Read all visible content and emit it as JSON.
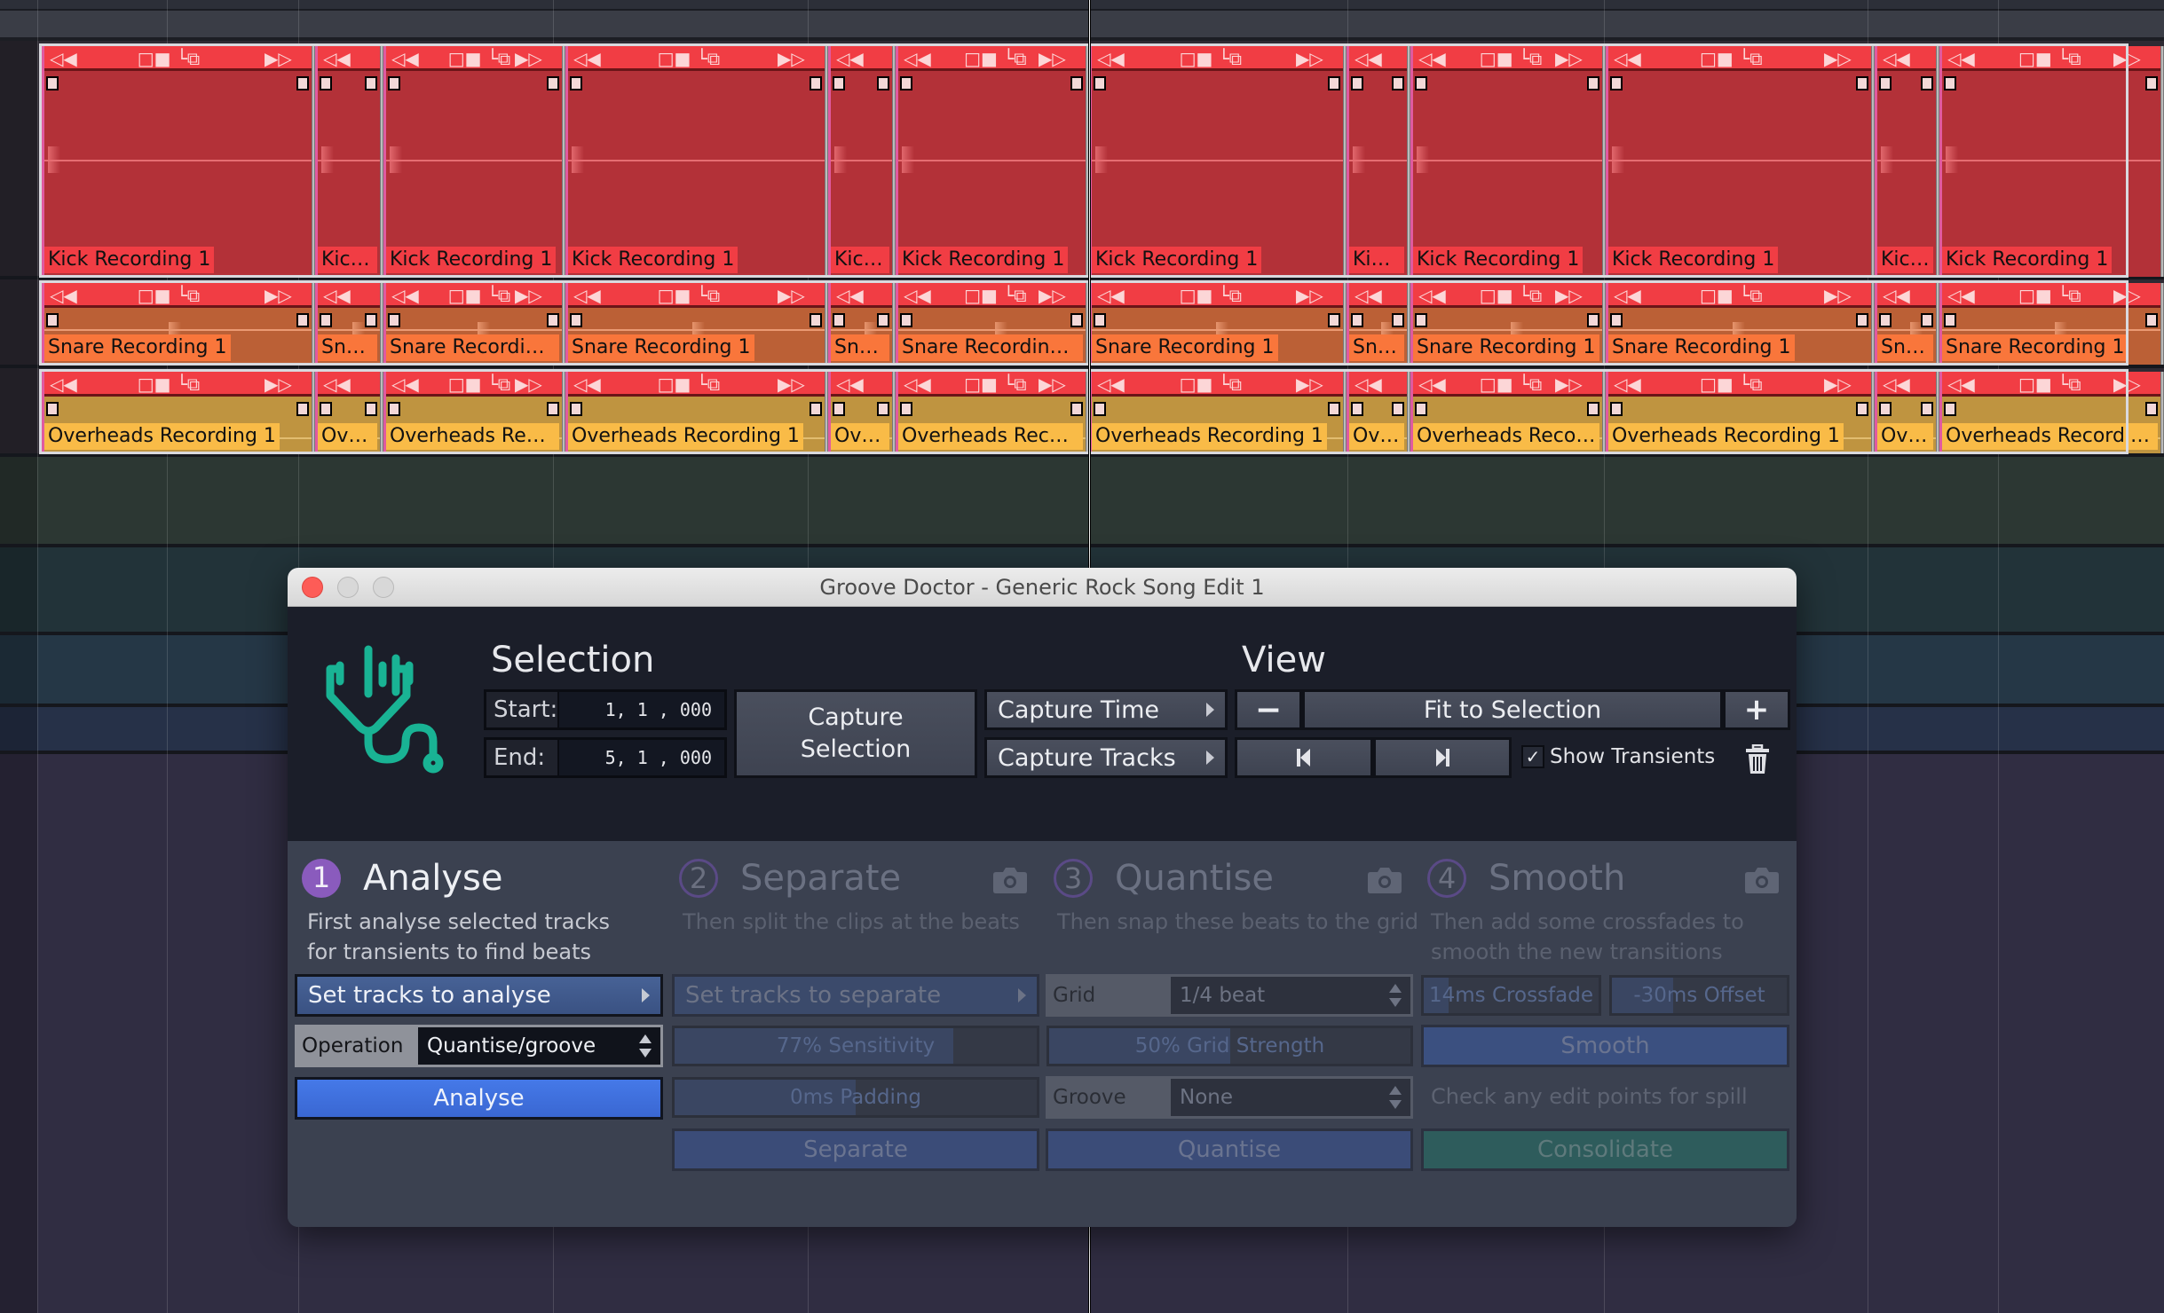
{
  "window": {
    "title": "Groove Doctor - Generic Rock Song Edit 1"
  },
  "tracks": [
    {
      "id": "kick",
      "clip_name": "Kick Recording 1",
      "truncated": "Kick ...",
      "color": "#f13d44"
    },
    {
      "id": "snare",
      "clip_name": "Snare Recording 1",
      "truncated": "Snar...",
      "color": "#f9763b"
    },
    {
      "id": "overheads",
      "clip_name": "Overheads Recording 1",
      "truncated": "Ove...",
      "color": "#f9bb47"
    }
  ],
  "clips": {
    "kick": [
      "Kick Recording 1",
      "Kick ...",
      "Kick Recording 1",
      "Kick Recording 1",
      "Kick ...",
      "Kick Recording 1",
      "Kick Recording 1",
      "Kick...",
      "Kick Recording 1",
      "Kick Recording 1",
      "Kick...",
      "Kick Recording 1"
    ],
    "snare": [
      "Snare Recording 1",
      "Snar...",
      "Snare Recording 1",
      "Snare Recording 1",
      "Snar...",
      "Snare Recording 1",
      "Snare Recording 1",
      "Sna...",
      "Snare Recording 1",
      "Snare Recording 1",
      "Sna...",
      "Snare Recording 1"
    ],
    "overheads": [
      "Overheads Recording 1",
      "Ove...",
      "Overheads Reco...",
      "Overheads Recording 1",
      "Ove...",
      "Overheads Recor...",
      "Overheads Recording 1",
      "Ove...",
      "Overheads Recor...",
      "Overheads Recording 1",
      "Ove...",
      "Overheads Recording 1"
    ]
  },
  "clip_controls": {
    "nudge_left": "◁◀",
    "mid": "□■ └⧉",
    "nudge_right": "▶▷"
  },
  "selection": {
    "heading": "Selection",
    "start_label": "Start:",
    "start_value": "1, 1 , 000",
    "end_label": "End:",
    "end_value": "5, 1 , 000",
    "capture_selection": "Capture Selection",
    "capture_time": "Capture Time",
    "capture_tracks": "Capture Tracks"
  },
  "view": {
    "heading": "View",
    "zoom_out": "−",
    "fit": "Fit to Selection",
    "zoom_in": "+",
    "prev_icon": "skip-previous-icon",
    "next_icon": "skip-next-icon",
    "show_transients_label": "Show Transients",
    "show_transients_checked": true,
    "check_glyph": "✓"
  },
  "steps": [
    {
      "number": "1",
      "title": "Analyse",
      "active": true,
      "description": [
        "First analyse selected tracks",
        "for transients to find beats"
      ],
      "set_tracks": "Set tracks to analyse",
      "operation_label": "Operation",
      "operation_value": "Quantise/groove",
      "action": "Analyse"
    },
    {
      "number": "2",
      "title": "Separate",
      "active": false,
      "description": [
        "Then split the clips at the beats"
      ],
      "set_tracks": "Set tracks to separate",
      "sensitivity": {
        "label": "77% Sensitivity",
        "value": 0.77
      },
      "padding": {
        "label": "0ms Padding",
        "value": 0.5
      },
      "action": "Separate"
    },
    {
      "number": "3",
      "title": "Quantise",
      "active": false,
      "description": [
        "Then snap these beats to the grid"
      ],
      "grid_label": "Grid",
      "grid_value": "1/4 beat",
      "strength": {
        "label": "50% Grid Strength",
        "value": 0.5
      },
      "groove_label": "Groove",
      "groove_value": "None",
      "action": "Quantise"
    },
    {
      "number": "4",
      "title": "Smooth",
      "active": false,
      "description": [
        "Then add some crossfades to",
        "smooth the new transitions"
      ],
      "crossfade": {
        "label": "14ms Crossfade",
        "value": 0.14
      },
      "offset": {
        "label": "-30ms Offset",
        "value": 0.35
      },
      "smooth_action": "Smooth",
      "note": "Check any edit points for spill",
      "action": "Consolidate"
    }
  ],
  "colors": {
    "accent_blue": "#4579e8",
    "step_purple": "#8a5bbd",
    "logo_teal": "#19b394",
    "consolidate_teal": "#2e5c5c"
  }
}
